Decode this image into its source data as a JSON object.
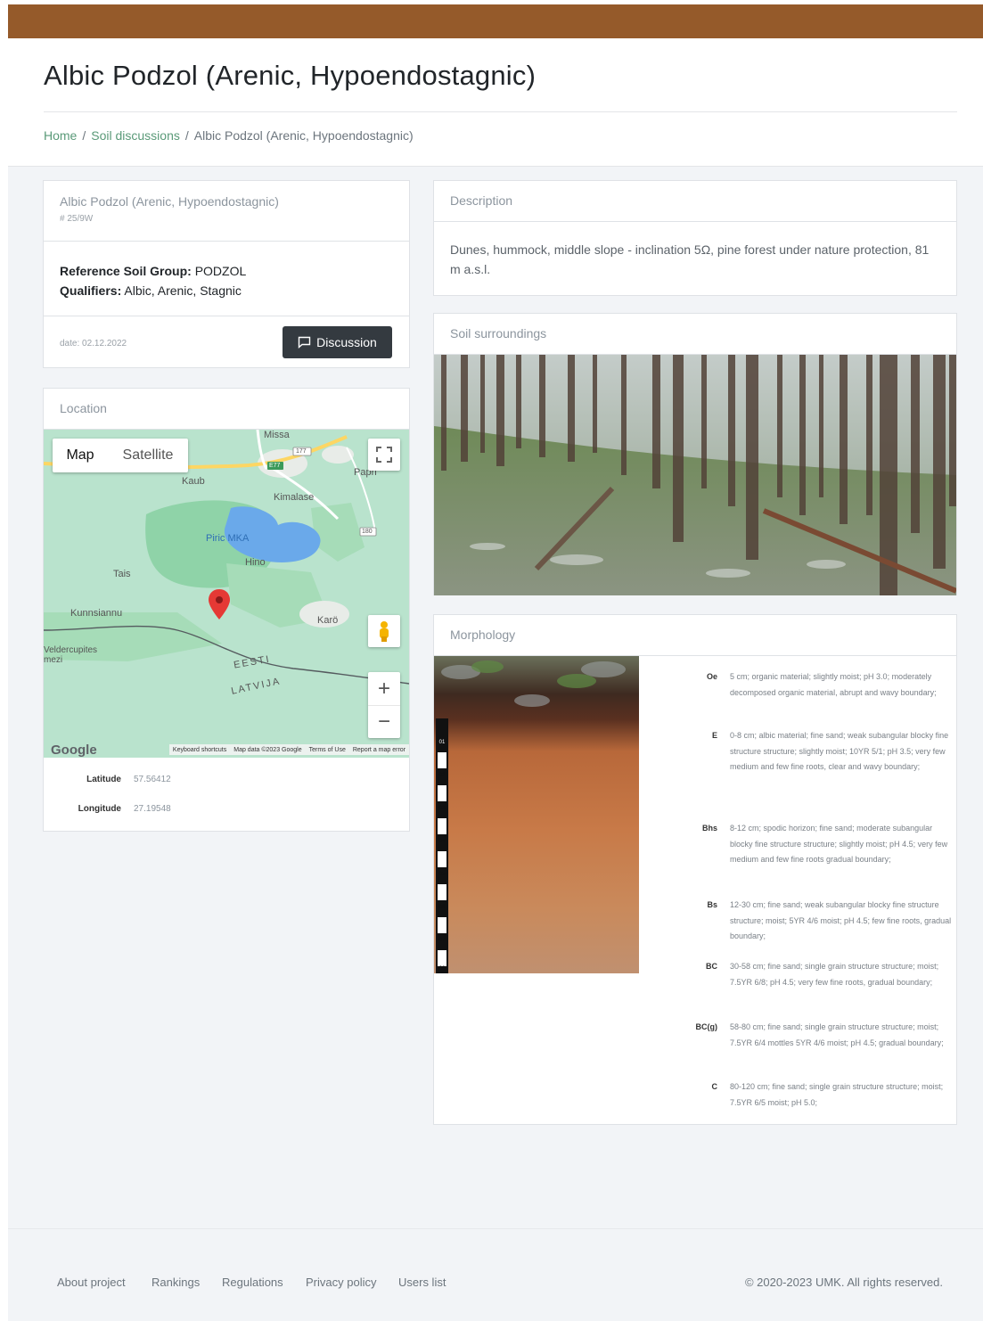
{
  "page": {
    "title": "Albic Podzol (Arenic, Hypoendostagnic)"
  },
  "breadcrumb": {
    "home": "Home",
    "discussions": "Soil discussions",
    "current": "Albic Podzol (Arenic, Hypoendostagnic)",
    "separator": "/"
  },
  "profile": {
    "name": "Albic Podzol (Arenic, Hypoendostagnic)",
    "id": "# 25/9W",
    "rsg_label": "Reference Soil Group:",
    "rsg_value": "PODZOL",
    "qualifiers_label": "Qualifiers:",
    "qualifiers_value": "Albic, Arenic, Stagnic",
    "date": "date: 02.12.2022",
    "discussion_button": "Discussion"
  },
  "location": {
    "header": "Location",
    "map_tab": "Map",
    "satellite_tab": "Satellite",
    "labels": [
      "Missa",
      "Papri",
      "Kaub",
      "Kimalase",
      "Piric MKA",
      "Hino",
      "Tais",
      "Kunnsiannu",
      "Karö",
      "Veldercupites mezi",
      "EESTI",
      "LATVIJA"
    ],
    "road_labels": [
      "E77",
      "177",
      "180"
    ],
    "zoom_in": "+",
    "zoom_out": "−",
    "google": "Google",
    "attribution": [
      "Keyboard shortcuts",
      "Map data ©2023 Google",
      "Terms of Use",
      "Report a map error"
    ],
    "latitude_label": "Latitude",
    "latitude_value": "57.56412",
    "longitude_label": "Longitude",
    "longitude_value": "27.19548",
    "colors": {
      "land": "#b9e3cd",
      "forest": "#8fd3a8",
      "water": "#6aa9ea",
      "marker": "#e53935"
    }
  },
  "description": {
    "header": "Description",
    "text": "Dunes, hummock, middle slope - inclination 5Ω, pine forest under nature protection, 81 m a.s.l."
  },
  "surroundings": {
    "header": "Soil surroundings"
  },
  "morphology": {
    "header": "Morphology",
    "scale_marks": [
      "01",
      "02",
      "03",
      "04",
      "05",
      "06",
      "07",
      "08"
    ],
    "horizons": [
      {
        "code": "Oe",
        "text": "5 cm; organic material; slightly moist; pH 3.0; moderately decomposed organic material, abrupt and wavy boundary;"
      },
      {
        "code": "E",
        "text": "0-8 cm; albic material; fine sand; weak subangular blocky fine structure structure; slightly moist; 10YR 5/1; pH 3.5; very few medium and few fine roots, clear and wavy boundary;"
      },
      {
        "code": "Bhs",
        "text": "8-12 cm; spodic horizon; fine sand; moderate subangular blocky fine structure structure; slightly moist; pH 4.5; very few medium and few fine roots gradual boundary;"
      },
      {
        "code": "Bs",
        "text": "12-30 cm; fine sand; weak subangular blocky fine structure structure; moist; 5YR 4/6 moist; pH 4.5; few fine roots, gradual boundary;"
      },
      {
        "code": "BC",
        "text": "30-58 cm; fine sand; single grain structure structure; moist; 7.5YR 6/8; pH 4.5; very few fine roots, gradual boundary;"
      },
      {
        "code": "BC(g)",
        "text": "58-80 cm; fine sand; single grain structure structure; moist; 7.5YR 6/4 mottles 5YR 4/6 moist; pH 4.5; gradual boundary;"
      },
      {
        "code": "C",
        "text": "80-120 cm; fine sand; single grain structure structure; moist; 7.5YR 6/5 moist; pH 5.0;"
      }
    ]
  },
  "footer": {
    "links": [
      "About project",
      "Rankings",
      "Regulations",
      "Privacy policy",
      "Users list"
    ],
    "copyright": "© 2020-2023 UMK. All rights reserved."
  },
  "theme": {
    "brand": "#955a2a",
    "link": "#5a9a78",
    "button": "#343a40",
    "background": "#f2f4f7"
  }
}
